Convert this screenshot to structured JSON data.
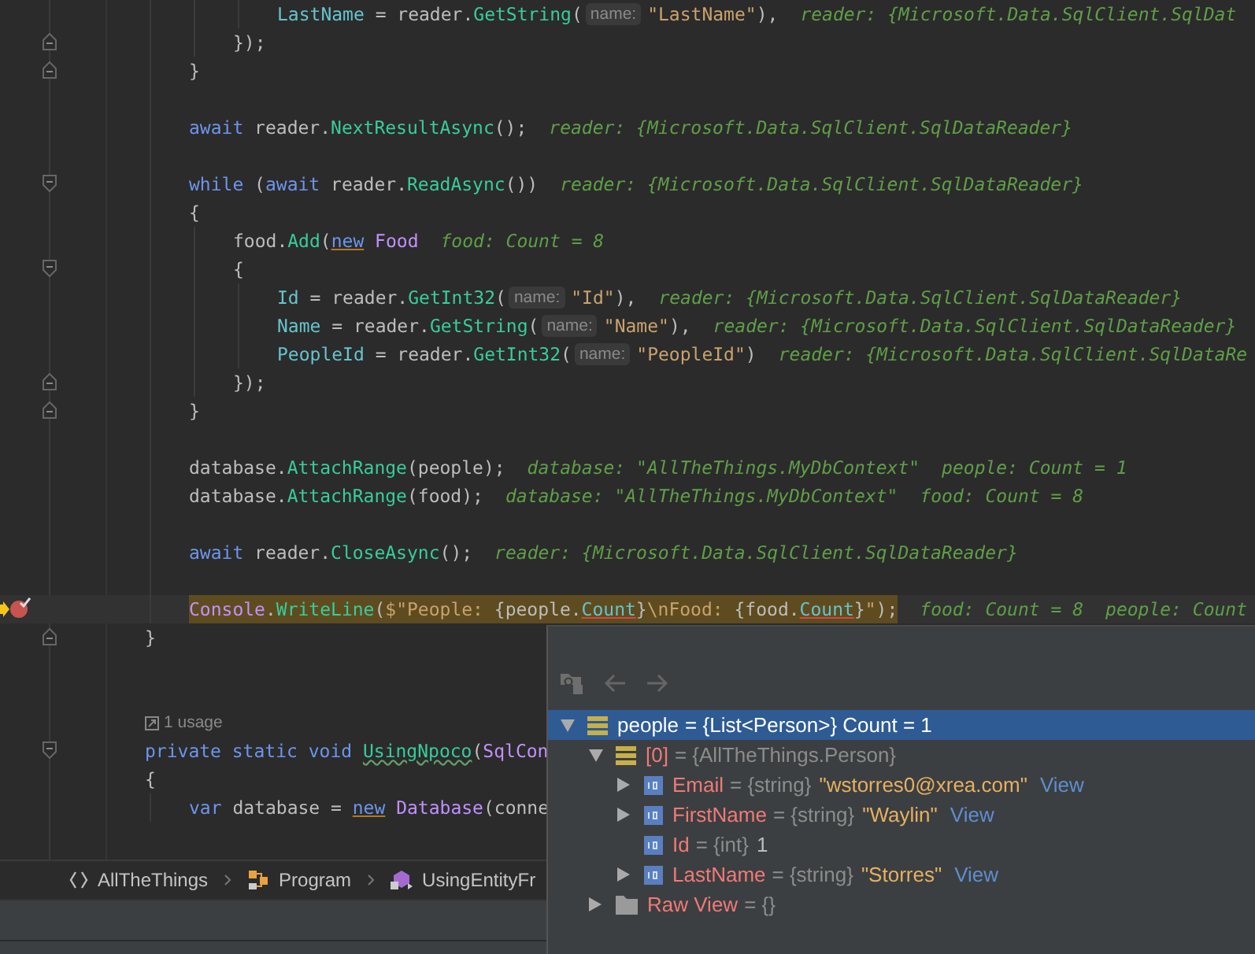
{
  "editor": {
    "lines": [
      {
        "kind": "group",
        "children": [
          {
            "kind": "group",
            "children": [
              {
                "kind": "group",
                "children": [
                  {
                    "kind": "code",
                    "tokens": [
                      {
                        "kind": "property",
                        "text": "LastName"
                      },
                      {
                        "kind": "plain",
                        "text": " = reader."
                      },
                      {
                        "kind": "method",
                        "text": "GetString"
                      },
                      {
                        "kind": "plain",
                        "text": "("
                      },
                      {
                        "kind": "param",
                        "text": "name:"
                      },
                      {
                        "kind": "string",
                        "text": "\"LastName\""
                      },
                      {
                        "kind": "plain",
                        "text": "),"
                      },
                      {
                        "kind": "hint",
                        "text": "reader: {Microsoft.Data.SqlClient.SqlDat"
                      }
                    ]
                  }
                ]
              },
              {
                "kind": "code",
                "fold_end": true,
                "tokens": [
                  {
                    "kind": "plain",
                    "text": "});"
                  }
                ]
              }
            ]
          },
          {
            "kind": "code",
            "fold_end": true,
            "tokens": [
              {
                "kind": "plain",
                "text": "}"
              }
            ]
          },
          {
            "kind": "blank"
          },
          {
            "kind": "code",
            "tokens": [
              {
                "kind": "keyword",
                "text": "await"
              },
              {
                "kind": "plain",
                "text": " reader."
              },
              {
                "kind": "method",
                "text": "NextResultAsync"
              },
              {
                "kind": "plain",
                "text": "();"
              },
              {
                "kind": "hint",
                "text": "reader: {Microsoft.Data.SqlClient.SqlDataReader}"
              }
            ]
          },
          {
            "kind": "blank"
          },
          {
            "kind": "code",
            "fold_start": true,
            "tokens": [
              {
                "kind": "keyword",
                "text": "while"
              },
              {
                "kind": "plain",
                "text": " ("
              },
              {
                "kind": "keyword",
                "text": "await"
              },
              {
                "kind": "plain",
                "text": " reader."
              },
              {
                "kind": "method",
                "text": "ReadAsync"
              },
              {
                "kind": "plain",
                "text": "())"
              },
              {
                "kind": "hint",
                "text": "reader: {Microsoft.Data.SqlClient.SqlDataReader}"
              }
            ]
          },
          {
            "kind": "code",
            "tokens": [
              {
                "kind": "plain",
                "text": "{"
              }
            ]
          },
          {
            "kind": "group",
            "children": [
              {
                "kind": "code",
                "tokens": [
                  {
                    "kind": "plain",
                    "text": "food."
                  },
                  {
                    "kind": "method",
                    "text": "Add"
                  },
                  {
                    "kind": "plain",
                    "text": "("
                  },
                  {
                    "kind": "keyword",
                    "text": "new",
                    "warning": true
                  },
                  {
                    "kind": "type",
                    "text": " Food"
                  },
                  {
                    "kind": "hint",
                    "text": "food: Count = 8"
                  }
                ]
              },
              {
                "kind": "code",
                "fold_start": true,
                "tokens": [
                  {
                    "kind": "plain",
                    "text": "{"
                  }
                ]
              },
              {
                "kind": "group",
                "children": [
                  {
                    "kind": "code",
                    "tokens": [
                      {
                        "kind": "property",
                        "text": "Id"
                      },
                      {
                        "kind": "plain",
                        "text": " = reader."
                      },
                      {
                        "kind": "method",
                        "text": "GetInt32"
                      },
                      {
                        "kind": "plain",
                        "text": "("
                      },
                      {
                        "kind": "param",
                        "text": "name:"
                      },
                      {
                        "kind": "string",
                        "text": "\"Id\""
                      },
                      {
                        "kind": "plain",
                        "text": "),"
                      },
                      {
                        "kind": "hint",
                        "text": "reader: {Microsoft.Data.SqlClient.SqlDataReader}"
                      }
                    ]
                  },
                  {
                    "kind": "code",
                    "tokens": [
                      {
                        "kind": "property",
                        "text": "Name"
                      },
                      {
                        "kind": "plain",
                        "text": " = reader."
                      },
                      {
                        "kind": "method",
                        "text": "GetString"
                      },
                      {
                        "kind": "plain",
                        "text": "("
                      },
                      {
                        "kind": "param",
                        "text": "name:"
                      },
                      {
                        "kind": "string",
                        "text": "\"Name\""
                      },
                      {
                        "kind": "plain",
                        "text": "),"
                      },
                      {
                        "kind": "hint",
                        "text": "reader: {Microsoft.Data.SqlClient.SqlDataReader}"
                      }
                    ]
                  },
                  {
                    "kind": "code",
                    "tokens": [
                      {
                        "kind": "property",
                        "text": "PeopleId"
                      },
                      {
                        "kind": "plain",
                        "text": " = reader."
                      },
                      {
                        "kind": "method",
                        "text": "GetInt32"
                      },
                      {
                        "kind": "plain",
                        "text": "("
                      },
                      {
                        "kind": "param",
                        "text": "name:"
                      },
                      {
                        "kind": "string",
                        "text": "\"PeopleId\""
                      },
                      {
                        "kind": "plain",
                        "text": ")"
                      },
                      {
                        "kind": "hint",
                        "text": "reader: {Microsoft.Data.SqlClient.SqlDataRe"
                      }
                    ]
                  }
                ]
              },
              {
                "kind": "code",
                "fold_end": true,
                "tokens": [
                  {
                    "kind": "plain",
                    "text": "});"
                  }
                ]
              }
            ]
          },
          {
            "kind": "code",
            "fold_end": true,
            "tokens": [
              {
                "kind": "plain",
                "text": "}"
              }
            ]
          },
          {
            "kind": "blank"
          },
          {
            "kind": "code",
            "tokens": [
              {
                "kind": "plain",
                "text": "database."
              },
              {
                "kind": "method",
                "text": "AttachRange"
              },
              {
                "kind": "plain",
                "text": "(people);"
              },
              {
                "kind": "hint",
                "text": "database: \"AllTheThings.MyDbContext\""
              },
              {
                "kind": "hint",
                "text": "people: Count = 1"
              }
            ]
          },
          {
            "kind": "code",
            "tokens": [
              {
                "kind": "plain",
                "text": "database."
              },
              {
                "kind": "method",
                "text": "AttachRange"
              },
              {
                "kind": "plain",
                "text": "(food);"
              },
              {
                "kind": "hint",
                "text": "database: \"AllTheThings.MyDbContext\""
              },
              {
                "kind": "hint",
                "text": "food: Count = 8"
              }
            ]
          },
          {
            "kind": "blank"
          },
          {
            "kind": "code",
            "tokens": [
              {
                "kind": "keyword",
                "text": "await"
              },
              {
                "kind": "plain",
                "text": " reader."
              },
              {
                "kind": "method",
                "text": "CloseAsync"
              },
              {
                "kind": "plain",
                "text": "();"
              },
              {
                "kind": "hint",
                "text": "reader: {Microsoft.Data.SqlClient.SqlDataReader}"
              }
            ]
          },
          {
            "kind": "blank"
          },
          {
            "kind": "code",
            "current": true,
            "breakpoint": true,
            "highlighted": true,
            "tokens": [
              {
                "kind": "type",
                "text": "Console"
              },
              {
                "kind": "plain",
                "text": "."
              },
              {
                "kind": "method",
                "text": "WriteLine"
              },
              {
                "kind": "plain",
                "text": "("
              },
              {
                "kind": "string",
                "text": "$\"People: "
              },
              {
                "kind": "plain",
                "text": "{people."
              },
              {
                "kind": "property",
                "text": "Count",
                "error": true
              },
              {
                "kind": "plain",
                "text": "}"
              },
              {
                "kind": "string",
                "text": "\\nFood: "
              },
              {
                "kind": "plain",
                "text": "{food."
              },
              {
                "kind": "property",
                "text": "Count",
                "error": true
              },
              {
                "kind": "plain",
                "text": "}"
              },
              {
                "kind": "string",
                "text": "\""
              },
              {
                "kind": "plain",
                "text": ");"
              },
              {
                "kind": "hint",
                "text": "food: Count = 8"
              },
              {
                "kind": "hint",
                "text": "people: Count"
              }
            ]
          }
        ]
      },
      {
        "kind": "code",
        "fold_end": true,
        "tokens": [
          {
            "kind": "plain",
            "text": "}"
          }
        ]
      },
      {
        "kind": "blank"
      },
      {
        "kind": "blank"
      },
      {
        "kind": "usage",
        "text": "1 usage"
      },
      {
        "kind": "code",
        "fold_start": true,
        "tokens": [
          {
            "kind": "keyword",
            "text": "private static void "
          },
          {
            "kind": "method",
            "text": "UsingNpoco",
            "typo": true
          },
          {
            "kind": "plain",
            "text": "("
          },
          {
            "kind": "type",
            "text": "SqlCon"
          }
        ]
      },
      {
        "kind": "code",
        "tokens": [
          {
            "kind": "plain",
            "text": "{"
          }
        ]
      },
      {
        "kind": "group",
        "children": [
          {
            "kind": "code",
            "tokens": [
              {
                "kind": "keyword",
                "text": "var"
              },
              {
                "kind": "plain",
                "text": " database = "
              },
              {
                "kind": "keyword",
                "text": "new",
                "warning": true
              },
              {
                "kind": "type",
                "text": " Database"
              },
              {
                "kind": "plain",
                "text": "(conne"
              }
            ]
          }
        ]
      }
    ]
  },
  "breadcrumb": [
    {
      "kind": "namespace",
      "label": "AllTheThings"
    },
    {
      "kind": "class",
      "label": "Program"
    },
    {
      "kind": "method",
      "label": "UsingEntityFr"
    }
  ],
  "debugger_popup": {
    "tree": [
      {
        "kind": "list",
        "name": "people",
        "detail": "= {List<Person>} Count = 1",
        "expanded": true,
        "selected": true,
        "children": [
          {
            "kind": "list",
            "name": "[0]",
            "detail": "= {AllTheThings.Person}",
            "expanded": true,
            "selected": false,
            "children": [
              {
                "kind": "field",
                "name": "Email",
                "detail": "= {string}",
                "value": "\"wstorres0@xrea.com\"",
                "string_value": true,
                "link": "View",
                "expanded": false,
                "selected": false
              },
              {
                "kind": "field",
                "name": "FirstName",
                "detail": "= {string}",
                "value": "\"Waylin\"",
                "string_value": true,
                "link": "View",
                "expanded": false,
                "selected": false
              },
              {
                "kind": "field",
                "name": "Id",
                "detail": "= {int}",
                "value": "1",
                "string_value": false,
                "selected": false
              },
              {
                "kind": "field",
                "name": "LastName",
                "detail": "= {string}",
                "value": "\"Storres\"",
                "string_value": true,
                "link": "View",
                "expanded": false,
                "selected": false
              }
            ]
          },
          {
            "kind": "folder",
            "name": "Raw View",
            "detail": "= {}",
            "expanded": false,
            "selected": false
          }
        ]
      }
    ]
  }
}
